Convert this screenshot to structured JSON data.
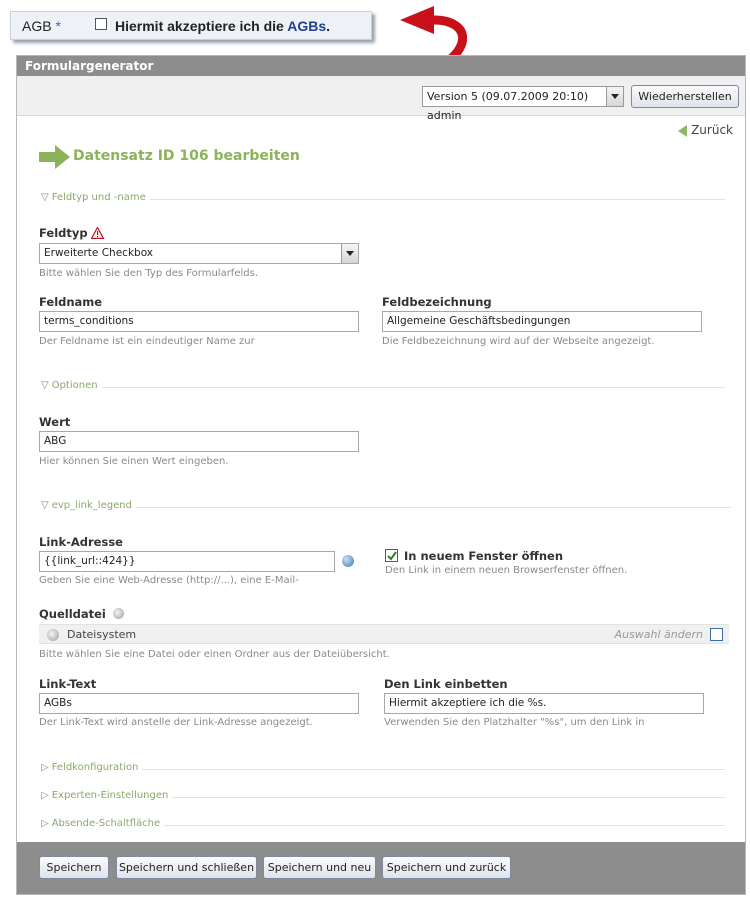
{
  "preview": {
    "label": "AGB",
    "required_mark": "*",
    "text_before": "Hiermit akzeptiere ich die ",
    "link_text": "AGBs",
    "text_after": "."
  },
  "panel": {
    "title": "Formulargenerator",
    "version_select": "Version 5 (09.07.2009 20:10) admin",
    "restore_button": "Wiederherstellen",
    "back_link": "Zurück",
    "headline": "Datensatz ID 106 bearbeiten"
  },
  "sections": {
    "type_name": "Feldtyp und -name",
    "options": "Optionen",
    "link": "evp_link_legend",
    "field_config": "Feldkonfiguration",
    "expert": "Experten-Einstellungen",
    "submit": "Absende-Schaltfläche"
  },
  "fields": {
    "feldtyp": {
      "label": "Feldtyp",
      "value": "Erweiterte Checkbox",
      "hint": "Bitte wählen Sie den Typ des Formularfelds."
    },
    "feldname": {
      "label": "Feldname",
      "value": "terms_conditions",
      "hint": "Der Feldname ist ein eindeutiger Name zur"
    },
    "feldbezeichnung": {
      "label": "Feldbezeichnung",
      "value": "Allgemeine Geschäftsbedingungen",
      "hint": "Die Feldbezeichnung wird auf der Webseite angezeigt."
    },
    "wert": {
      "label": "Wert",
      "value": "ABG",
      "hint": "Hier können Sie einen Wert eingeben."
    },
    "link_adresse": {
      "label": "Link-Adresse",
      "value": "{{link_url::424}}",
      "hint": "Geben Sie eine Web-Adresse (http://...), eine E-Mail-"
    },
    "neues_fenster": {
      "label": "In neuem Fenster öffnen",
      "checked": true,
      "hint": "Den Link in einem neuen Browserfenster öffnen."
    },
    "quelldatei": {
      "label": "Quelldatei",
      "source": "Dateisystem",
      "change": "Auswahl ändern",
      "hint": "Bitte wählen Sie eine Datei oder einen Ordner aus der Dateiübersicht."
    },
    "link_text": {
      "label": "Link-Text",
      "value": "AGBs",
      "hint": "Der Link-Text wird anstelle der Link-Adresse angezeigt."
    },
    "link_einbetten": {
      "label": "Den Link einbetten",
      "value": "Hiermit akzeptiere ich die %s.",
      "hint": "Verwenden Sie den Platzhalter \"%s\", um den Link in"
    }
  },
  "buttons": {
    "save": "Speichern",
    "save_close": "Speichern und schließen",
    "save_new": "Speichern und neu",
    "save_back": "Speichern und zurück"
  },
  "colors": {
    "accent_green": "#8cb35a",
    "panel_header": "#8d8d8d",
    "arrow_red": "#c8101a",
    "link_blue": "#1d3f8f"
  },
  "icons": {
    "curved_arrow": "red-curved-arrow-icon",
    "headline_arrow": "green-arrow-icon",
    "back": "back-arrow-icon",
    "warning": "warning-icon",
    "globe": "globe-icon",
    "source_file": "file-icon"
  }
}
